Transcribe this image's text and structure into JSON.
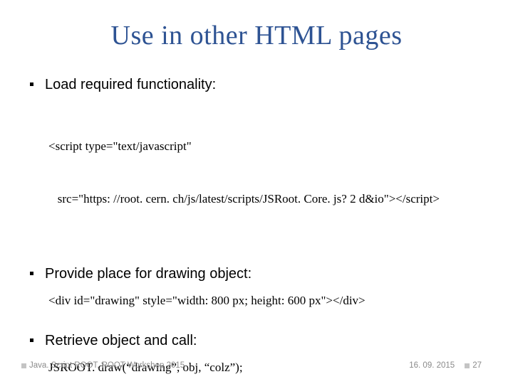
{
  "title": "Use in other HTML pages",
  "bullets": {
    "b1": "Load required functionality:",
    "b2": "Provide place for drawing object:",
    "b3": "Retrieve object and call:"
  },
  "code": {
    "c1a": "<script type=\"text/javascript\"",
    "c1b": "   src=\"https: //root. cern. ch/js/latest/scripts/JSRoot. Core. js? 2 d&io\"></script>",
    "c2": "<div id=\"drawing\" style=\"width: 800 px; height: 600 px\"></div>",
    "c3": "JSROOT. draw(“drawing”, obj, “colz”);"
  },
  "footer": {
    "left": "Java. Script ROOT, ROOT Workshop 2015",
    "date": "16. 09. 2015",
    "page": "27"
  }
}
